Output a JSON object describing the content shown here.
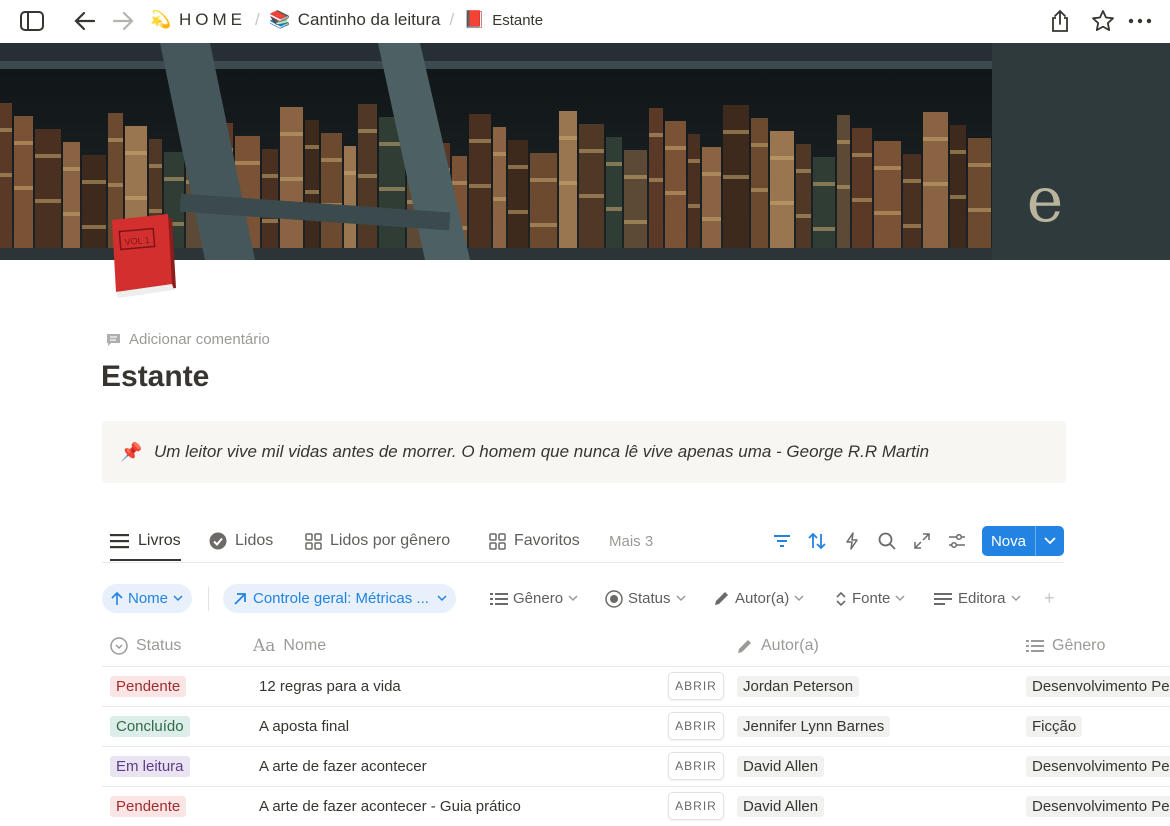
{
  "topbar": {
    "breadcrumbs": [
      {
        "emoji": "💫",
        "label": "HOME"
      },
      {
        "emoji": "📚",
        "label": "Cantinho da leitura"
      },
      {
        "emoji": "📕",
        "label": "Estante"
      }
    ]
  },
  "page": {
    "add_comment": "Adicionar comentário",
    "title": "Estante",
    "callout": {
      "emoji": "📌",
      "text": "Um leitor vive mil vidas antes de morrer. O homem que nunca lê vive apenas uma - George R.R Martin"
    },
    "cover_letter": "e",
    "icon_label": "VOL 1"
  },
  "views": {
    "tabs": [
      {
        "label": "Livros",
        "icon": "list-icon"
      },
      {
        "label": "Lidos",
        "icon": "check-circle-icon"
      },
      {
        "label": "Lidos por gênero",
        "icon": "gallery-icon"
      },
      {
        "label": "Favoritos",
        "icon": "gallery-icon"
      }
    ],
    "more": "Mais 3",
    "new_button": "Nova",
    "accent_color": "#2383e2"
  },
  "filters": {
    "sort": "Nome",
    "relation": "Controle geral: Métricas ...",
    "properties": [
      "Gênero",
      "Status",
      "Autor(a)",
      "Fonte",
      "Editora"
    ]
  },
  "table": {
    "columns": [
      "Status",
      "Nome",
      "Autor(a)",
      "Gênero"
    ],
    "open_label": "ABRIR",
    "rows": [
      {
        "status": "Pendente",
        "status_color": "#fbe4e4",
        "status_text": "#9f2e31",
        "name": "12 regras para a vida",
        "author": "Jordan Peterson",
        "genre": "Desenvolvimento Pe"
      },
      {
        "status": "Concluído",
        "status_color": "#ddedea",
        "status_text": "#2f6b45",
        "name": "A aposta final",
        "author": "Jennifer Lynn Barnes",
        "genre": "Ficção"
      },
      {
        "status": "Em leitura",
        "status_color": "#eae4f2",
        "status_text": "#5b3d86",
        "name": "A arte de fazer acontecer",
        "author": "David Allen",
        "genre": "Desenvolvimento Pe"
      },
      {
        "status": "Pendente",
        "status_color": "#fbe4e4",
        "status_text": "#9f2e31",
        "name": "A arte de fazer acontecer - Guia prático",
        "author": "David Allen",
        "genre": "Desenvolvimento Pe"
      }
    ]
  }
}
